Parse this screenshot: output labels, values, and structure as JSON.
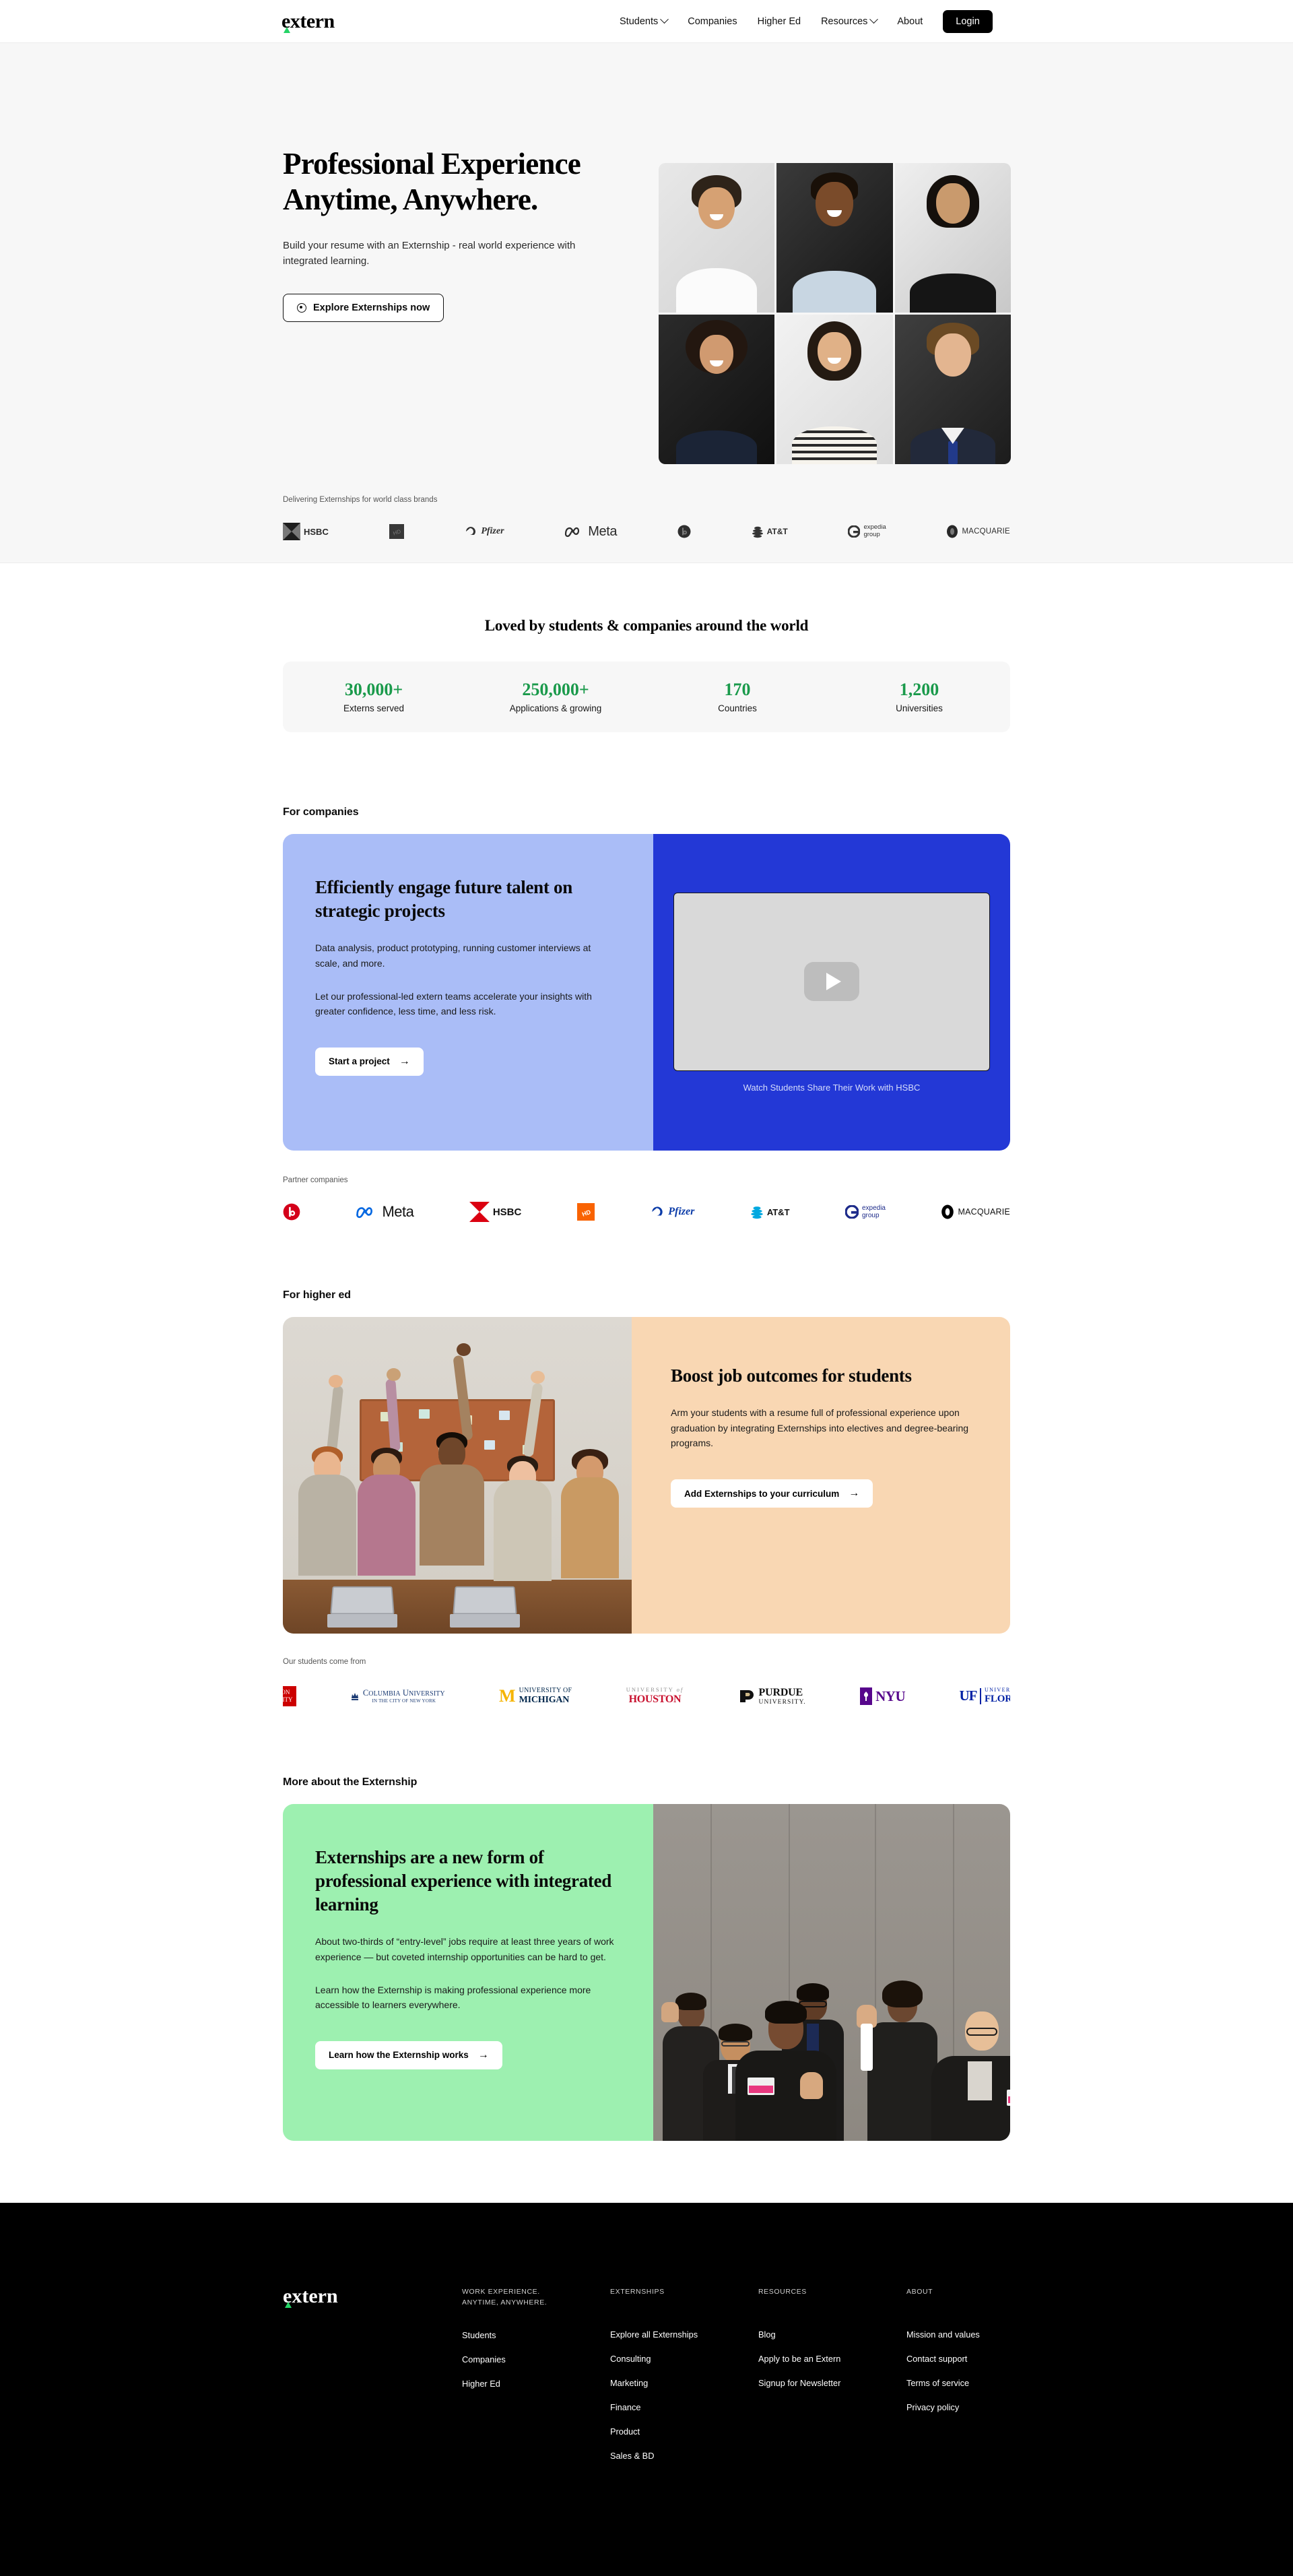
{
  "nav": {
    "logo": "extern",
    "items": [
      {
        "label": "Students",
        "has_dropdown": true
      },
      {
        "label": "Companies",
        "has_dropdown": false
      },
      {
        "label": "Higher Ed",
        "has_dropdown": false
      },
      {
        "label": "Resources",
        "has_dropdown": true
      },
      {
        "label": "About",
        "has_dropdown": false
      }
    ],
    "login": "Login"
  },
  "hero": {
    "title_line1": "Professional Experience",
    "title_line2": "Anytime, Anywhere.",
    "subtitle": "Build your resume with an Externship - real world experience with integrated learning.",
    "cta": "Explore Externships now",
    "brands_label": "Delivering Externships for world class brands",
    "brands": [
      "HSBC",
      "The Home Depot",
      "Pfizer",
      "Meta",
      "Beats by Dre",
      "AT&T",
      "expedia group",
      "MACQUARIE"
    ]
  },
  "loved": {
    "title": "Loved by students & companies around the world",
    "stats": [
      {
        "value": "30,000+",
        "label": "Externs served"
      },
      {
        "value": "250,000+",
        "label": "Applications & growing"
      },
      {
        "value": "170",
        "label": "Countries"
      },
      {
        "value": "1,200",
        "label": "Universities"
      }
    ],
    "accent_color": "#1a9a4b"
  },
  "companies": {
    "section_label": "For companies",
    "heading": "Efficiently engage future talent on strategic projects",
    "paragraph1": "Data analysis, product prototyping, running customer interviews at scale, and more.",
    "paragraph2": "Let our professional-led extern teams accelerate your insights with greater confidence, less time, and less risk.",
    "cta": "Start a project",
    "video_caption": "Watch Students Share Their Work with HSBC",
    "partners_label": "Partner companies",
    "partners": [
      "Beats by Dre",
      "Meta",
      "HSBC",
      "The Home Depot",
      "Pfizer",
      "AT&T",
      "expedia group",
      "MACQUARIE"
    ],
    "left_bg": "#aabdf7",
    "right_bg": "#2338d6"
  },
  "higher_ed": {
    "section_label": "For higher ed",
    "heading": "Boost job outcomes for students",
    "paragraph": "Arm your students with a resume full of professional experience upon graduation by integrating Externships into electives and degree-bearing programs.",
    "cta": "Add Externships to your curriculum",
    "students_label": "Our students come from",
    "universities": [
      "BOSTON UNIVERSITY",
      "COLUMBIA UNIVERSITY IN THE CITY OF NEW YORK",
      "UNIVERSITY OF MICHIGAN",
      "UNIVERSITY of HOUSTON",
      "PURDUE UNIVERSITY",
      "NYU",
      "UF UNIVERSITY of FLORIDA"
    ],
    "bg": "#f9d7b3"
  },
  "more_about": {
    "section_label": "More about the Externship",
    "heading": "Externships are a new form of professional experience with integrated learning",
    "paragraph1": "About two-thirds of “entry-level” jobs require at least three years of work experience — but coveted internship opportunities can be hard to get.",
    "paragraph2": "Learn how the Externship is making professional experience more accessible to learners everywhere.",
    "cta": "Learn how the Externship works",
    "bg": "#9df0b0"
  },
  "footer": {
    "logo": "extern",
    "columns": [
      {
        "title": "WORK EXPERIENCE. ANYTIME, ANYWHERE.",
        "links": [
          "Students",
          "Companies",
          "Higher Ed"
        ]
      },
      {
        "title": "EXTERNSHIPS",
        "links": [
          "Explore all Externships",
          "Consulting",
          "Marketing",
          "Finance",
          "Product",
          "Sales & BD"
        ]
      },
      {
        "title": "RESOURCES",
        "links": [
          "Blog",
          "Apply to be an Extern",
          "Signup for Newsletter"
        ]
      },
      {
        "title": "ABOUT",
        "links": [
          "Mission and values",
          "Contact support",
          "Terms of service",
          "Privacy policy"
        ]
      }
    ]
  }
}
